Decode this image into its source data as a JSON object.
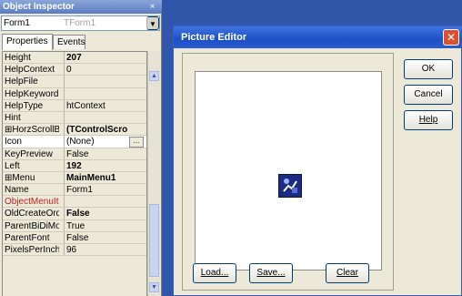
{
  "inspector": {
    "title": "Object Inspector",
    "close_glyph": "×",
    "object_name": "Form1",
    "object_type": "TForm1",
    "combo_arrow": "▼",
    "tabs": [
      "Properties",
      "Events"
    ],
    "properties": [
      {
        "name": "Height",
        "value": "207"
      },
      {
        "name": "HelpContext",
        "value": "0"
      },
      {
        "name": "HelpFile",
        "value": ""
      },
      {
        "name": "HelpKeyword",
        "value": ""
      },
      {
        "name": "HelpType",
        "value": "htContext"
      },
      {
        "name": "Hint",
        "value": ""
      },
      {
        "name": "⊞HorzScrollBar",
        "value": "(TControlScro"
      },
      {
        "name": "Icon",
        "value": "(None)",
        "ellipsis": "..."
      },
      {
        "name": "KeyPreview",
        "value": "False"
      },
      {
        "name": "Left",
        "value": "192"
      },
      {
        "name": "⊞Menu",
        "value": "MainMenu1"
      },
      {
        "name": "Name",
        "value": "Form1"
      },
      {
        "name": "ObjectMenuIter",
        "value": ""
      },
      {
        "name": "OldCreateOrder",
        "value": "False"
      },
      {
        "name": "ParentBiDiMod",
        "value": "True"
      },
      {
        "name": "ParentFont",
        "value": "False"
      },
      {
        "name": "PixelsPerInch",
        "value": "96"
      }
    ],
    "scroll_up": "▲",
    "scroll_down": "▼"
  },
  "picture_editor": {
    "title": "Picture Editor",
    "close_glyph": "✕",
    "buttons": {
      "ok": "OK",
      "cancel": "Cancel",
      "help": "Help",
      "load": "Load...",
      "save": "Save...",
      "clear": "Clear"
    }
  },
  "colors": {
    "desktop": "#2f56a8",
    "title_active": "#1d4fc4",
    "panel": "#ece9d8"
  }
}
